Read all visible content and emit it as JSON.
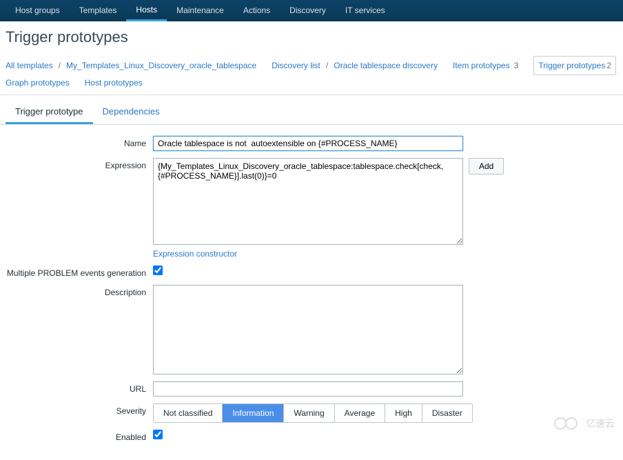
{
  "topnav": {
    "items": [
      {
        "label": "Host groups",
        "active": false
      },
      {
        "label": "Templates",
        "active": false
      },
      {
        "label": "Hosts",
        "active": true
      },
      {
        "label": "Maintenance",
        "active": false
      },
      {
        "label": "Actions",
        "active": false
      },
      {
        "label": "Discovery",
        "active": false
      },
      {
        "label": "IT services",
        "active": false
      }
    ]
  },
  "page": {
    "title": "Trigger prototypes"
  },
  "breadcrumb": {
    "line1": [
      {
        "type": "link",
        "label": "All templates"
      },
      {
        "type": "sep",
        "label": "/"
      },
      {
        "type": "link",
        "label": "My_Templates_Linux_Discovery_oracle_tablespace"
      },
      {
        "type": "gap"
      },
      {
        "type": "link",
        "label": "Discovery list"
      },
      {
        "type": "sep",
        "label": "/"
      },
      {
        "type": "link",
        "label": "Oracle tablespace discovery"
      },
      {
        "type": "gap"
      },
      {
        "type": "link",
        "label": "Item prototypes",
        "count": "3"
      },
      {
        "type": "gap"
      },
      {
        "type": "boxlink",
        "label": "Trigger prototypes",
        "count": "2"
      }
    ],
    "line2": [
      {
        "type": "link",
        "label": "Graph prototypes"
      },
      {
        "type": "gap"
      },
      {
        "type": "link",
        "label": "Host prototypes"
      }
    ]
  },
  "tabs": [
    {
      "label": "Trigger prototype",
      "active": true
    },
    {
      "label": "Dependencies",
      "active": false
    }
  ],
  "form": {
    "name_label": "Name",
    "name_value": "Oracle tablespace is not  autoextensible on {#PROCESS_NAME}",
    "expression_label": "Expression",
    "expression_value": "{My_Templates_Linux_Discovery_oracle_tablespace:tablespace.check[check,{#PROCESS_NAME}].last(0)}=0",
    "add_btn": "Add",
    "expression_constructor": "Expression constructor",
    "multi_label": "Multiple PROBLEM events generation",
    "multi_checked": true,
    "description_label": "Description",
    "description_value": "",
    "url_label": "URL",
    "url_value": "",
    "severity_label": "Severity",
    "severity_options": [
      {
        "label": "Not classified",
        "selected": false
      },
      {
        "label": "Information",
        "selected": true
      },
      {
        "label": "Warning",
        "selected": false
      },
      {
        "label": "Average",
        "selected": false
      },
      {
        "label": "High",
        "selected": false
      },
      {
        "label": "Disaster",
        "selected": false
      }
    ],
    "enabled_label": "Enabled",
    "enabled_checked": true
  },
  "watermark": "亿速云"
}
